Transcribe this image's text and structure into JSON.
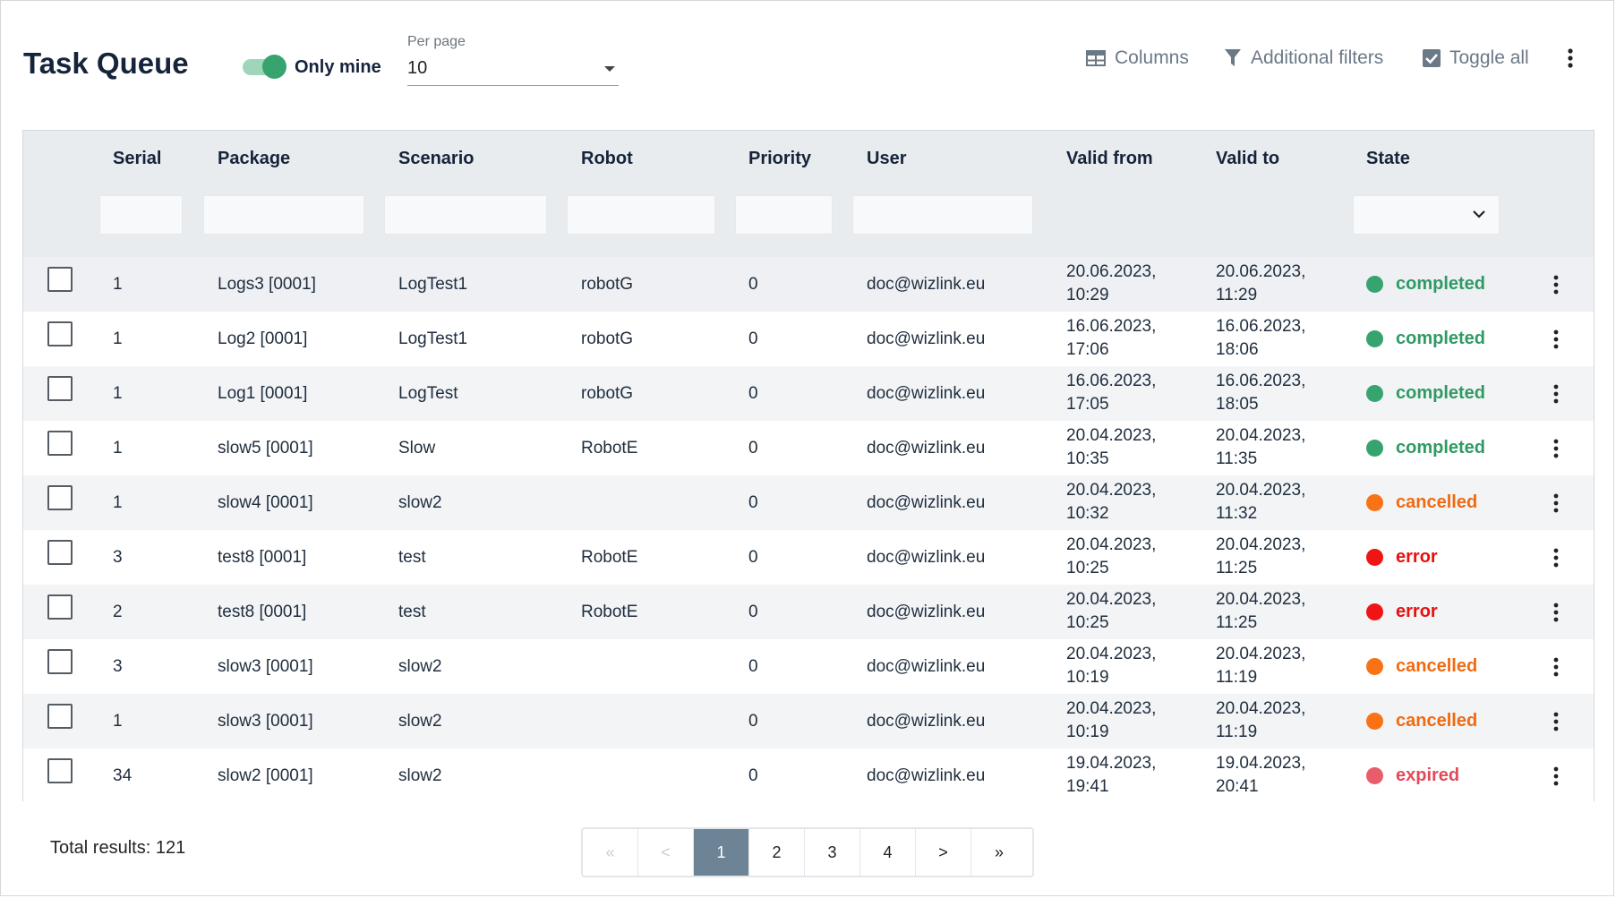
{
  "header": {
    "title": "Task Queue",
    "only_mine_label": "Only mine",
    "only_mine_on": true,
    "per_page_label": "Per page",
    "per_page_value": "10",
    "columns_label": "Columns",
    "filters_label": "Additional filters",
    "toggle_all_label": "Toggle all"
  },
  "table": {
    "columns": [
      "Serial",
      "Package",
      "Scenario",
      "Robot",
      "Priority",
      "User",
      "Valid from",
      "Valid to",
      "State"
    ],
    "rows": [
      {
        "serial": "1",
        "package": "Logs3 [0001]",
        "scenario": "LogTest1",
        "robot": "robotG",
        "priority": "0",
        "user": "doc@wizlink.eu",
        "valid_from_date": "20.06.2023,",
        "valid_from_time": "10:29",
        "valid_to_date": "20.06.2023,",
        "valid_to_time": "11:29",
        "state": "completed"
      },
      {
        "serial": "1",
        "package": "Log2 [0001]",
        "scenario": "LogTest1",
        "robot": "robotG",
        "priority": "0",
        "user": "doc@wizlink.eu",
        "valid_from_date": "16.06.2023,",
        "valid_from_time": "17:06",
        "valid_to_date": "16.06.2023,",
        "valid_to_time": "18:06",
        "state": "completed"
      },
      {
        "serial": "1",
        "package": "Log1 [0001]",
        "scenario": "LogTest",
        "robot": "robotG",
        "priority": "0",
        "user": "doc@wizlink.eu",
        "valid_from_date": "16.06.2023,",
        "valid_from_time": "17:05",
        "valid_to_date": "16.06.2023,",
        "valid_to_time": "18:05",
        "state": "completed"
      },
      {
        "serial": "1",
        "package": "slow5 [0001]",
        "scenario": "Slow",
        "robot": "RobotE",
        "priority": "0",
        "user": "doc@wizlink.eu",
        "valid_from_date": "20.04.2023,",
        "valid_from_time": "10:35",
        "valid_to_date": "20.04.2023,",
        "valid_to_time": "11:35",
        "state": "completed"
      },
      {
        "serial": "1",
        "package": "slow4 [0001]",
        "scenario": "slow2",
        "robot": "",
        "priority": "0",
        "user": "doc@wizlink.eu",
        "valid_from_date": "20.04.2023,",
        "valid_from_time": "10:32",
        "valid_to_date": "20.04.2023,",
        "valid_to_time": "11:32",
        "state": "cancelled"
      },
      {
        "serial": "3",
        "package": "test8 [0001]",
        "scenario": "test",
        "robot": "RobotE",
        "priority": "0",
        "user": "doc@wizlink.eu",
        "valid_from_date": "20.04.2023,",
        "valid_from_time": "10:25",
        "valid_to_date": "20.04.2023,",
        "valid_to_time": "11:25",
        "state": "error"
      },
      {
        "serial": "2",
        "package": "test8 [0001]",
        "scenario": "test",
        "robot": "RobotE",
        "priority": "0",
        "user": "doc@wizlink.eu",
        "valid_from_date": "20.04.2023,",
        "valid_from_time": "10:25",
        "valid_to_date": "20.04.2023,",
        "valid_to_time": "11:25",
        "state": "error"
      },
      {
        "serial": "3",
        "package": "slow3 [0001]",
        "scenario": "slow2",
        "robot": "",
        "priority": "0",
        "user": "doc@wizlink.eu",
        "valid_from_date": "20.04.2023,",
        "valid_from_time": "10:19",
        "valid_to_date": "20.04.2023,",
        "valid_to_time": "11:19",
        "state": "cancelled"
      },
      {
        "serial": "1",
        "package": "slow3 [0001]",
        "scenario": "slow2",
        "robot": "",
        "priority": "0",
        "user": "doc@wizlink.eu",
        "valid_from_date": "20.04.2023,",
        "valid_from_time": "10:19",
        "valid_to_date": "20.04.2023,",
        "valid_to_time": "11:19",
        "state": "cancelled"
      },
      {
        "serial": "34",
        "package": "slow2 [0001]",
        "scenario": "slow2",
        "robot": "",
        "priority": "0",
        "user": "doc@wizlink.eu",
        "valid_from_date": "19.04.2023,",
        "valid_from_time": "19:41",
        "valid_to_date": "19.04.2023,",
        "valid_to_time": "20:41",
        "state": "expired"
      }
    ]
  },
  "state_colors": {
    "completed": {
      "dot": "#37a46f",
      "text": "#2f9a64"
    },
    "cancelled": {
      "dot": "#f97316",
      "text": "#f06a10"
    },
    "error": {
      "dot": "#f01414",
      "text": "#e81010"
    },
    "expired": {
      "dot": "#e85d6a",
      "text": "#e24a58"
    }
  },
  "footer": {
    "total_results": "Total results: 121",
    "pagination": [
      {
        "label": "«",
        "state": "disabled",
        "name": "first-page"
      },
      {
        "label": "<",
        "state": "disabled",
        "name": "prev-page"
      },
      {
        "label": "1",
        "state": "active",
        "name": "page-1"
      },
      {
        "label": "2",
        "state": "normal",
        "name": "page-2"
      },
      {
        "label": "3",
        "state": "normal",
        "name": "page-3"
      },
      {
        "label": "4",
        "state": "normal",
        "name": "page-4"
      },
      {
        "label": ">",
        "state": "normal",
        "name": "next-page"
      },
      {
        "label": "»",
        "state": "normal",
        "name": "last-page"
      }
    ]
  }
}
